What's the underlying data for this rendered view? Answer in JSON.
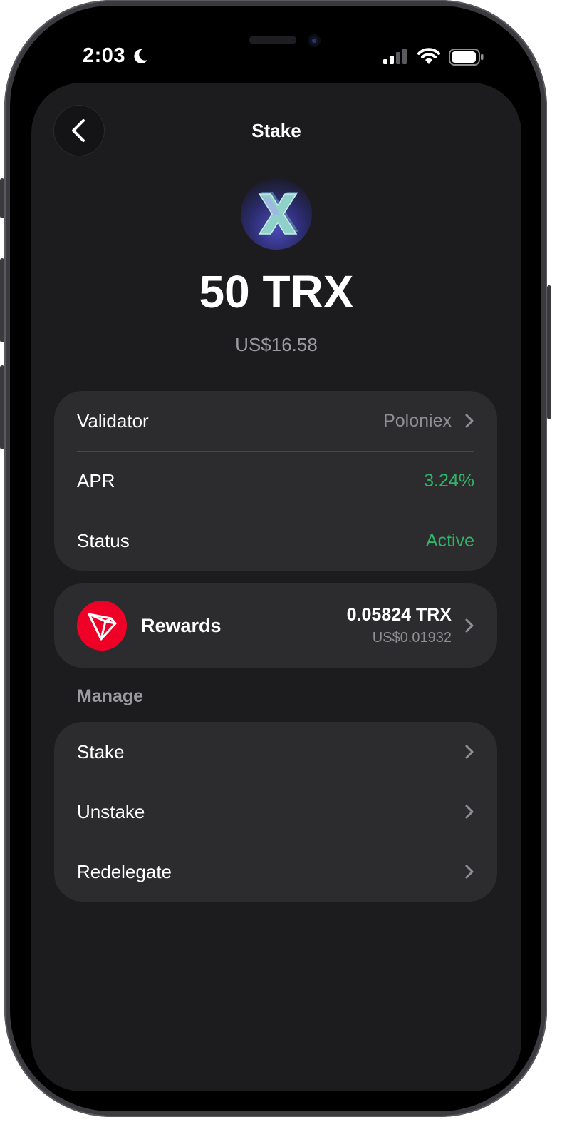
{
  "status_bar": {
    "time": "2:03"
  },
  "nav": {
    "title": "Stake"
  },
  "token": {
    "amount": "50 TRX",
    "fiat_value": "US$16.58"
  },
  "details": {
    "validator_label": "Validator",
    "validator_value": "Poloniex",
    "apr_label": "APR",
    "apr_value": "3.24%",
    "status_label": "Status",
    "status_value": "Active"
  },
  "rewards": {
    "label": "Rewards",
    "amount": "0.05824 TRX",
    "fiat": "US$0.01932"
  },
  "manage": {
    "title": "Manage",
    "items": [
      {
        "label": "Stake"
      },
      {
        "label": "Unstake"
      },
      {
        "label": "Redelegate"
      }
    ]
  },
  "colors": {
    "accent_green": "#30b467",
    "tron_red": "#ef0027",
    "card_bg": "#2c2c2e",
    "screen_bg": "#1c1c1e"
  },
  "icons": [
    "moon-icon",
    "signal-icon",
    "wifi-icon",
    "battery-icon",
    "back-chevron-icon",
    "token-logo-icon",
    "tron-logo-icon",
    "chevron-right-icon"
  ]
}
